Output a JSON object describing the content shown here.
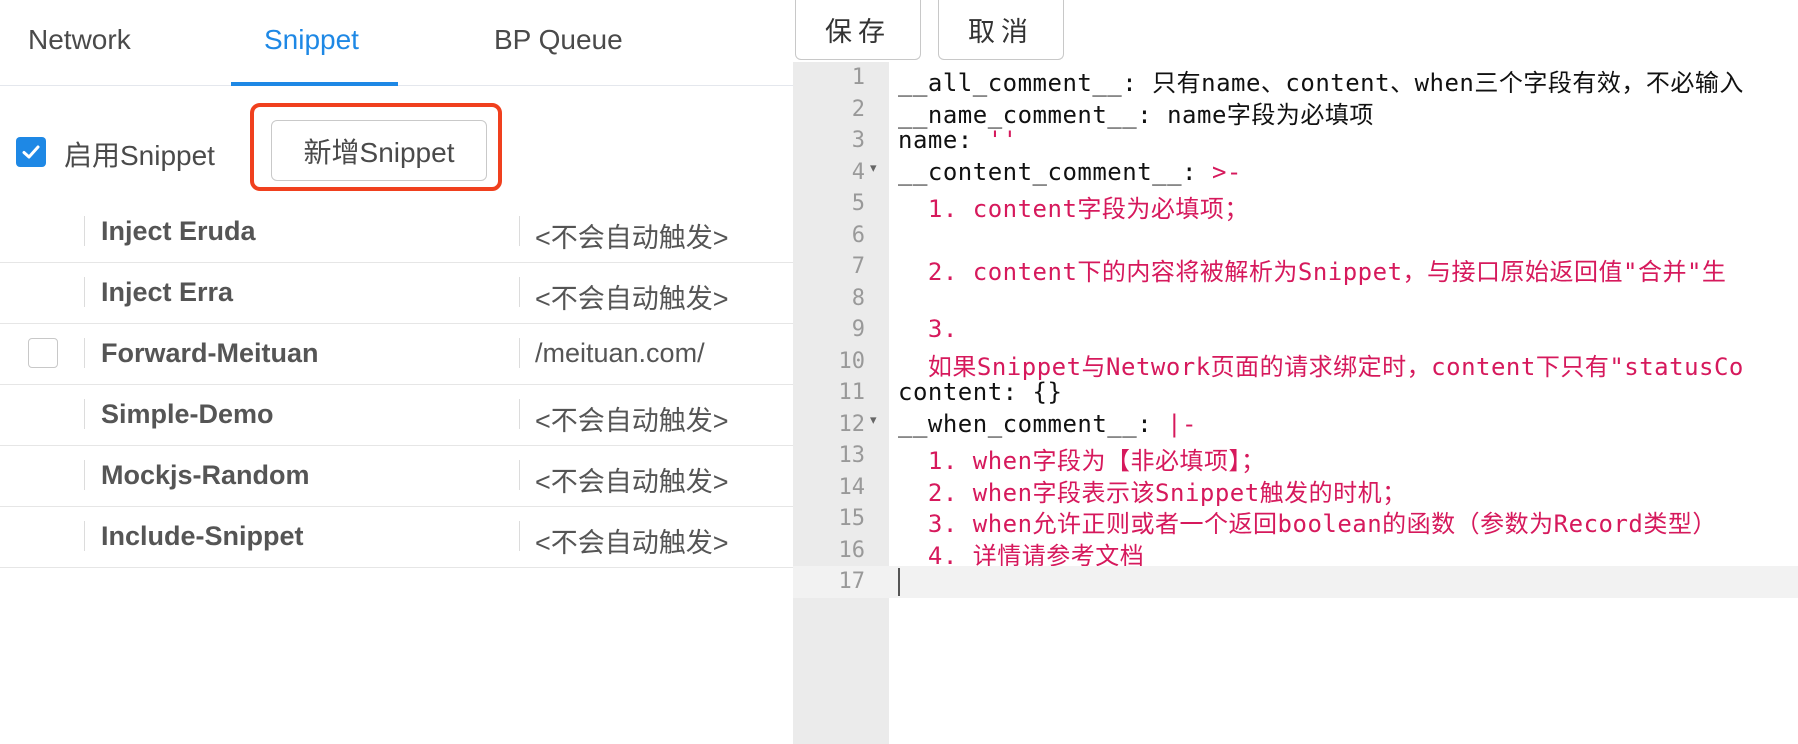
{
  "tabs": {
    "network": "Network",
    "snippet": "Snippet",
    "bp_queue": "BP Queue"
  },
  "toolbar": {
    "enable_label": "启用Snippet",
    "add_button": "新增Snippet"
  },
  "snippets": [
    {
      "name": "Inject Eruda",
      "when": "<不会自动触发>",
      "checkbox": false
    },
    {
      "name": "Inject Erra",
      "when": "<不会自动触发>",
      "checkbox": false
    },
    {
      "name": "Forward-Meituan",
      "when": "/meituan.com/",
      "checkbox": true
    },
    {
      "name": "Simple-Demo",
      "when": "<不会自动触发>",
      "checkbox": false
    },
    {
      "name": "Mockjs-Random",
      "when": "<不会自动触发>",
      "checkbox": false
    },
    {
      "name": "Include-Snippet",
      "when": "<不会自动触发>",
      "checkbox": false
    }
  ],
  "editor_buttons": {
    "save": "保存",
    "cancel": "取消"
  },
  "editor_lines": [
    {
      "n": "1",
      "k": "__all_comment__: ",
      "v": "只有name、content、when三个字段有效，不必输入"
    },
    {
      "n": "2",
      "k": "__name_comment__: ",
      "v": "name字段为必填项"
    },
    {
      "n": "3",
      "k": "name: ",
      "r": "''"
    },
    {
      "n": "4",
      "k": "__content_comment__: ",
      "r": ">-",
      "fold": true
    },
    {
      "n": "5",
      "r": "  1. content字段为必填项；"
    },
    {
      "n": "6"
    },
    {
      "n": "7",
      "r": "  2. content下的内容将被解析为Snippet，与接口原始返回值\"合并\"生"
    },
    {
      "n": "8"
    },
    {
      "n": "9",
      "r": "  3."
    },
    {
      "n": "10",
      "r": "  如果Snippet与Network页面的请求绑定时，content下只有\"statusCo"
    },
    {
      "n": "11",
      "k": "content: {}"
    },
    {
      "n": "12",
      "k": "__when_comment__: ",
      "r": "|-",
      "fold": true
    },
    {
      "n": "13",
      "r": "  1. when字段为【非必填项】；"
    },
    {
      "n": "14",
      "r": "  2. when字段表示该Snippet触发的时机；"
    },
    {
      "n": "15",
      "r": "  3. when允许正则或者一个返回boolean的函数（参数为Record类型）"
    },
    {
      "n": "16",
      "r": "  4. 详情请参考文档"
    },
    {
      "n": "17",
      "active": true,
      "cursor": true
    }
  ],
  "colors": {
    "accent": "#1e88e5",
    "highlight_border": "#f0401e",
    "string_red": "#d6195c"
  },
  "icons": {
    "checkbox_checked": "checkmark-icon",
    "fold_marker": "chevron-down-icon"
  }
}
